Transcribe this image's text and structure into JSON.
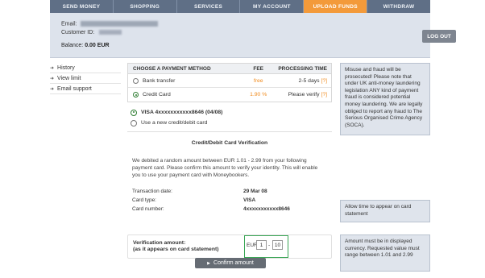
{
  "nav": {
    "tabs": [
      {
        "label": "SEND MONEY",
        "active": false
      },
      {
        "label": "SHOPPING",
        "active": false
      },
      {
        "label": "SERVICES",
        "active": false
      },
      {
        "label": "MY ACCOUNT",
        "active": false
      },
      {
        "label": "UPLOAD FUNDS",
        "active": true
      },
      {
        "label": "WITHDRAW",
        "active": false
      }
    ],
    "active_color": "#f39a3a",
    "tab_color": "#5f6f86"
  },
  "account": {
    "email_label": "Email:",
    "customer_id_label": "Customer ID:",
    "balance_label": "Balance:",
    "balance_value": "0.00 EUR",
    "logout_label": "LOG OUT"
  },
  "sidebar": {
    "items": [
      {
        "label": "History"
      },
      {
        "label": "View limit"
      },
      {
        "label": "Email support"
      }
    ]
  },
  "payment": {
    "headers": {
      "method": "CHOOSE A PAYMENT METHOD",
      "fee": "FEE",
      "time": "PROCESSING TIME"
    },
    "rows": [
      {
        "method": "Bank transfer",
        "fee": "free",
        "time": "2-5 days",
        "help": "[?]",
        "selected": false
      },
      {
        "method": "Credit Card",
        "fee": "1.90 %",
        "time": "Please verify",
        "help": "[?]",
        "selected": true
      }
    ]
  },
  "cards": {
    "selected_card": "VISA 4xxxxxxxxxxx8646 (04/08)",
    "new_card": "Use a new credit/debit card"
  },
  "verification": {
    "title": "Credit/Debit Card Verification",
    "text": "We debited a random amount between EUR 1.01 - 2.99 from your following payment card. Please confirm this amount to verify your identity. This will enable you to use your payment card with Moneybookers.",
    "details": [
      {
        "label": "Transaction date:",
        "value": "29 Mar 08"
      },
      {
        "label": "Card type:",
        "value": "VISA"
      },
      {
        "label": "Card number:",
        "value": "4xxxxxxxxxxx8646"
      }
    ],
    "amount_label_line1": "Verification amount:",
    "amount_label_line2": "(as it appears on card statement)",
    "currency": "EUR",
    "value_whole": "1",
    "separator": "-",
    "value_fraction": "10",
    "confirm_label": "Confirm amount"
  },
  "info": {
    "fraud_notice": "Misuse and fraud will be prosecuted! Please note that under UK anti-money laundering legislation ANY kind of payment fraud is considered potential money laundering. We are legally obliged to report any fraud to The Serious Organised Crime Agency (SOCA).",
    "statement_notice": "Allow time to appear on card statement",
    "amount_notice": "Amount must be in displayed currency. Requested value must range between 1.01 and 2.99"
  }
}
